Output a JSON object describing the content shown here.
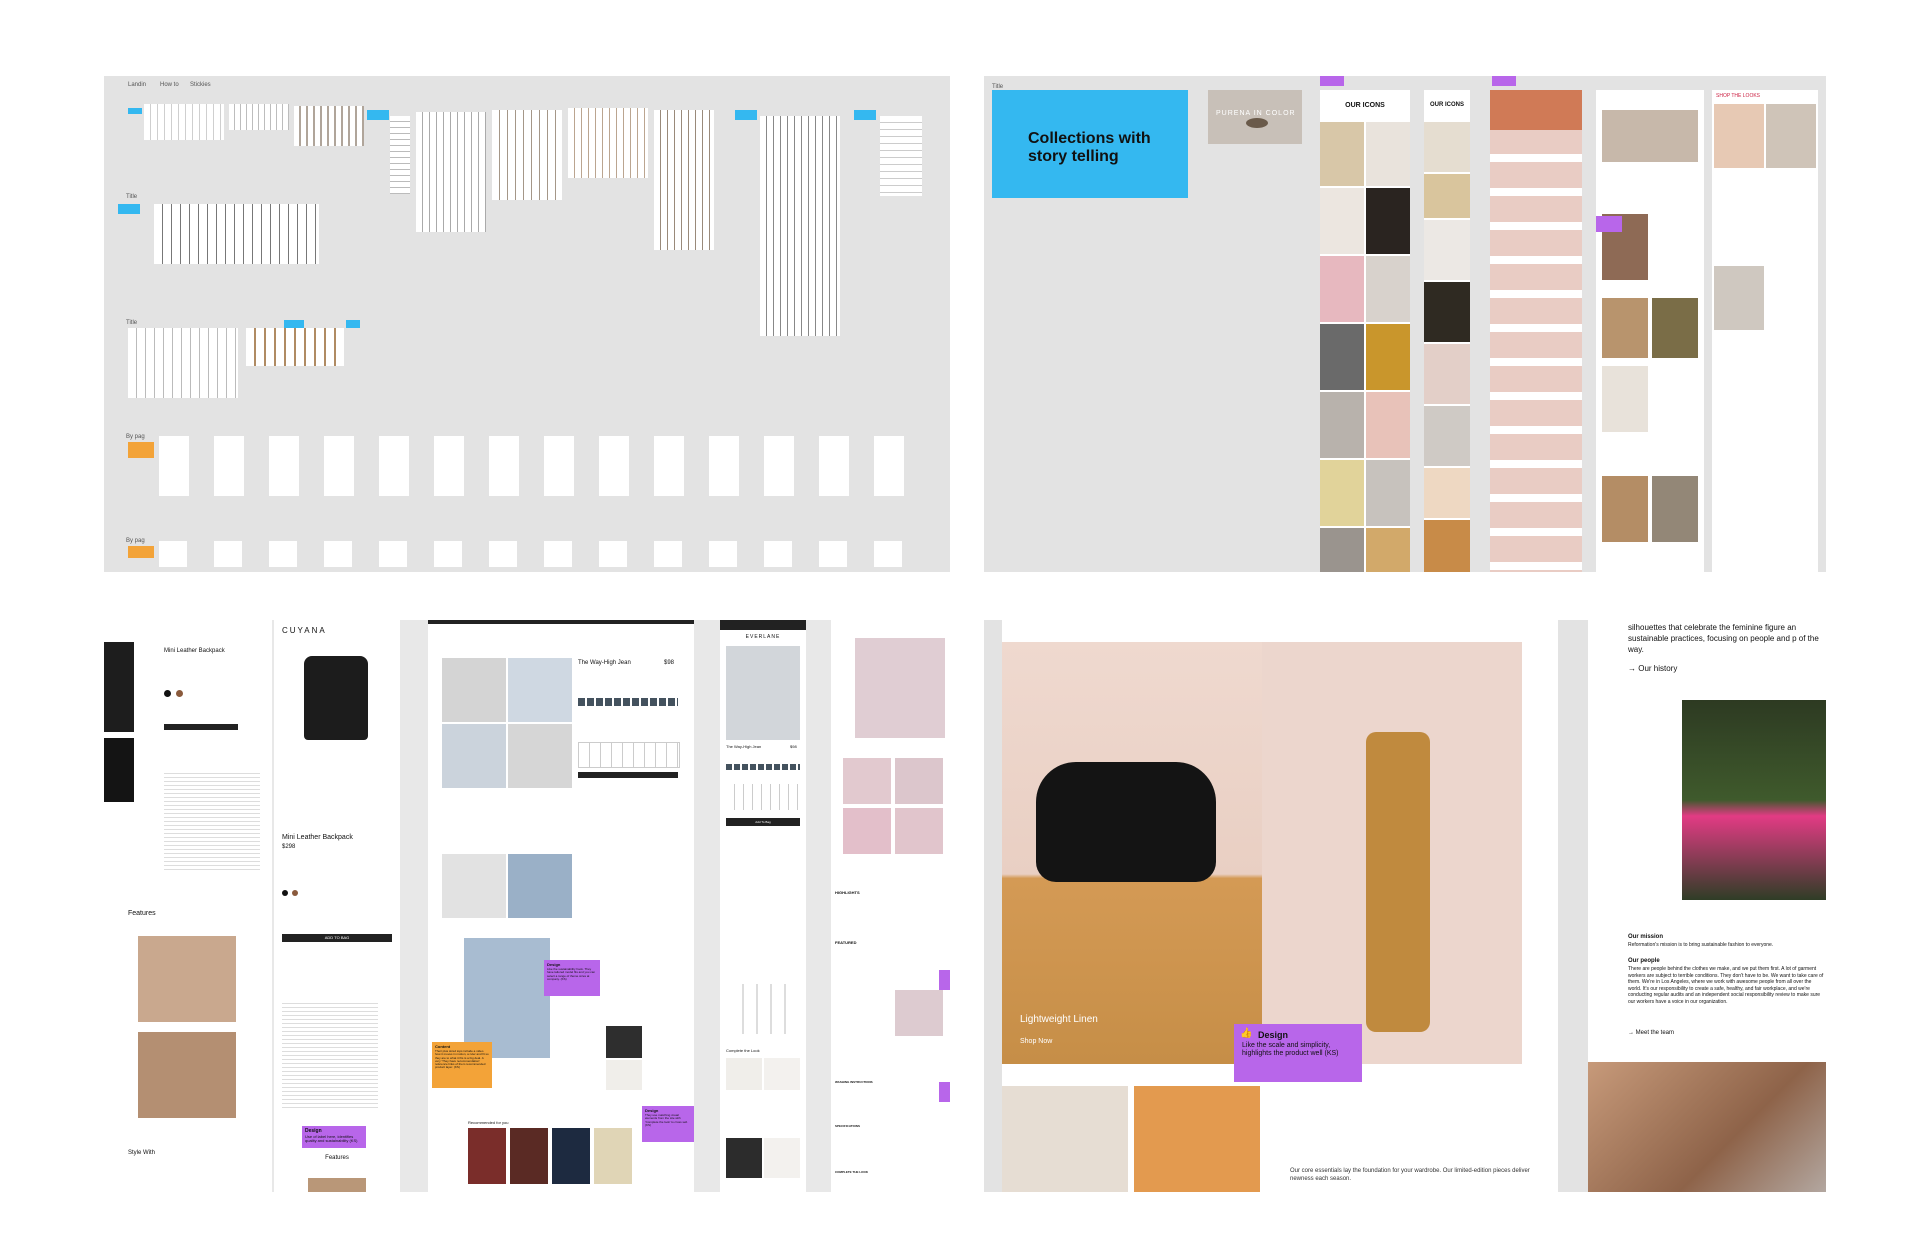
{
  "top_left": {
    "top_labels": [
      "Landin",
      "How to",
      "Stickies"
    ],
    "section_title": "Title",
    "row_label_1": "By pag",
    "row_label_2": "By pag"
  },
  "top_right": {
    "title_small": "Title",
    "hero_title": "Collections with\nstory telling",
    "brand_chip": "PURENA IN COLOR",
    "icons_heading_1": "OUR ICONS",
    "icons_heading_2": "OUR ICONS",
    "shop_small": "SHOP THE LOOKS"
  },
  "bottom_left": {
    "left_product": {
      "title": "Mini Leather Backpack",
      "features_heading": "Features",
      "style_heading": "Style With"
    },
    "cuyana": {
      "brand": "CUYANA",
      "product_title": "Mini Leather Backpack",
      "price": "$298",
      "add_to_bag": "ADD TO BAG",
      "features_heading": "Features",
      "design_note_title": "Design",
      "design_note_body": "Use of label here, identifies quality and sustainability (KS)"
    },
    "everlane_desktop": {
      "product_title": "The Way-High Jean",
      "price": "$98",
      "design_note_title": "Design",
      "design_note_body": "Like the sustainability hook. They have tailored model fits and you can select a range of theme sizes at company. (KS)",
      "content_note_title": "Content",
      "content_note_body": "Their plus sized tops include a video how it moves in motion, a ruler and fit so they are to what it fits is a big deal. A very 'They have recommendation' reference links of them recommended product layer. (KS)",
      "design_note2_title": "Design",
      "design_note2_body": "They use matching visual elements from the site with 'Complete the look' to cross sell. (KS)",
      "recommended": "Recommended for you"
    },
    "everlane_mobile": {
      "brand": "EVERLANE",
      "product_title": "The Way-High Jean",
      "price": "$98",
      "add_to_bag": "Add To Bag",
      "complete_look": "Complete the Look"
    },
    "adidas": {
      "highlights": "HIGHLIGHTS",
      "featured": "FEATURED",
      "washing": "WASHING INSTRUCTIONS",
      "specs": "SPECIFICATIONS",
      "complete": "COMPLETE THE LOOK"
    }
  },
  "bottom_right": {
    "hero_caption": "Lightweight Linen",
    "hero_link": "Shop Now",
    "design_note_title": "Design",
    "design_note_body": "Like the scale and simplicity, highlights the product well (KS)",
    "bottom_copy": "Our core essentials lay the foundation for your wardrobe. Our limited-edition pieces deliver newness each season.",
    "right_text_top": "silhouettes that celebrate the feminine figure an sustainable practices, focusing on people and p of the way.",
    "our_history": "→ Our history",
    "mission_heading": "Our mission",
    "mission_body": "Reformation's mission is to bring sustainable fashion to everyone.",
    "people_heading": "Our people",
    "people_body": "There are people behind the clothes we make, and we put them first. A lot of garment workers are subject to terrible conditions. They don't have to be. We want to take care of them. We're in Los Angeles, where we work with awesome people from all over the world. It's our responsibility to create a safe, healthy, and fair workplace, and we're conducting regular audits and an independent social responsibility review to make sure our workers have a voice in our organization.",
    "meet_team": "→ Meet the team"
  },
  "colors": {
    "canvas": "#e3e3e3",
    "sticky_blue": "#34b8f0",
    "sticky_orange": "#f3a338",
    "sticky_purple": "#b866ea"
  }
}
